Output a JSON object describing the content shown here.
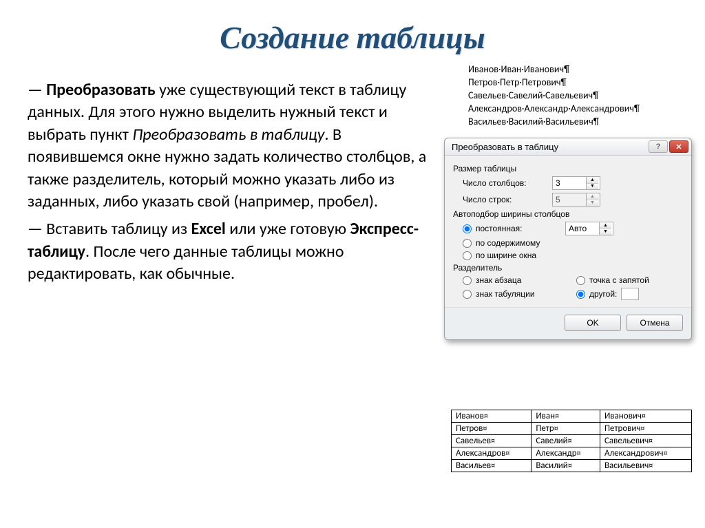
{
  "title": "Создание таблицы",
  "paragraph1": {
    "dash": "— ",
    "bold1": "Преобразовать",
    "text1": " уже существующий текст в таблицу данных. Для этого нужно выделить нужный текст и выбрать пункт ",
    "italic1": "Преобразовать в таблицу",
    "text2": ". В появившемся окне нужно задать количество столбцов, а также разделитель, который  можно указать либо из заданных, либо указать свой (например, пробел)."
  },
  "paragraph2": {
    "dash": "— Вставить таблицу из ",
    "bold1": "Excel",
    "text1": " или уже готовую ",
    "bold2": "Экспресс-таблицу",
    "text2": ". После чего данные таблицы можно редактировать, как обычные."
  },
  "names": [
    [
      "Иванов",
      "Иван",
      "Иванович"
    ],
    [
      "Петров",
      "Петр",
      "Петрович"
    ],
    [
      "Савельев",
      "Савелий",
      "Савельевич"
    ],
    [
      "Александров",
      "Александр",
      "Александрович"
    ],
    [
      "Васильев",
      "Василий",
      "Васильевич"
    ]
  ],
  "dialog": {
    "title": "Преобразовать в таблицу",
    "help": "?",
    "size_group": "Размер таблицы",
    "cols_label": "Число столбцов:",
    "cols_value": "3",
    "rows_label": "Число строк:",
    "rows_value": "5",
    "autofit_group": "Автоподбор ширины столбцов",
    "fixed_label": "постоянная:",
    "fixed_value": "Авто",
    "content_label": "по содержимому",
    "window_label": "по ширине окна",
    "sep_group": "Разделитель",
    "sep_para": "знак абзаца",
    "sep_semi": "точка с запятой",
    "sep_tab": "знак табуляции",
    "sep_other": "другой:",
    "ok": "OK",
    "cancel": "Отмена"
  },
  "table_rows": [
    [
      "Иванов",
      "Иван",
      "Иванович"
    ],
    [
      "Петров",
      "Петр",
      "Петрович"
    ],
    [
      "Савельев",
      "Савелий",
      "Савельевич"
    ],
    [
      "Александров",
      "Александр",
      "Александрович"
    ],
    [
      "Васильев",
      "Василий",
      "Васильевич"
    ]
  ]
}
